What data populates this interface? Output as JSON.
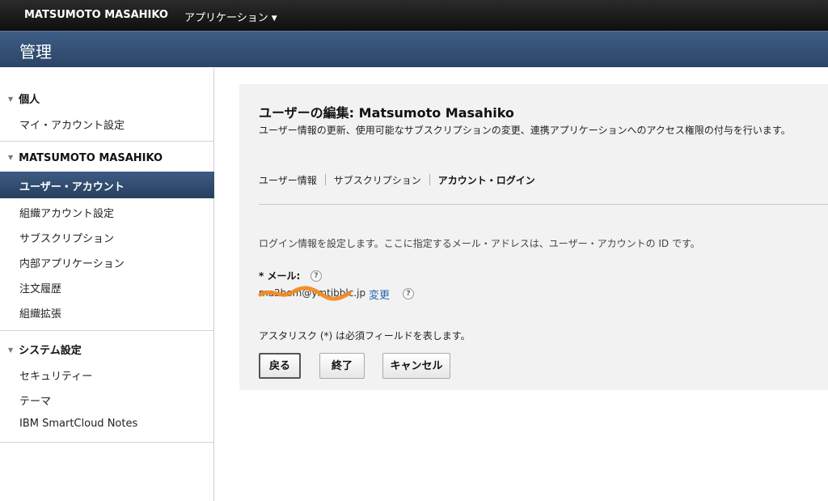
{
  "topbar": {
    "user_name": "MATSUMOTO MASAHIKO",
    "apps_label": "アプリケーション"
  },
  "header": {
    "title": "管理"
  },
  "sidebar": {
    "personal": {
      "heading": "個人",
      "items": [
        "マイ・アカウント設定"
      ]
    },
    "org": {
      "heading": "MATSUMOTO MASAHIKO",
      "items": [
        "ユーザー・アカウント",
        "組織アカウント設定",
        "サブスクリプション",
        "内部アプリケーション",
        "注文履歴",
        "組織拡張"
      ]
    },
    "system": {
      "heading": "システム設定",
      "items": [
        "セキュリティー",
        "テーマ",
        "IBM SmartCloud Notes"
      ]
    }
  },
  "main": {
    "title": "ユーザーの編集: Matsumoto Masahiko",
    "subtitle": "ユーザー情報の更新、使用可能なサブスクリプションの変更、連携アプリケーションへのアクセス権限の付与を行います。",
    "tabs": [
      "ユーザー情報",
      "サブスクリプション",
      "アカウント・ログイン"
    ],
    "active_tab": "アカウント・ログイン",
    "info_text": "ログイン情報を設定します。ここに指定するメール・アドレスは、ユーザー・アカウントの ID です。",
    "email_label": "* メール:",
    "email_value": "ma2bom@ymtibblc.jp",
    "change_link": "変更",
    "help_glyph": "?",
    "required_note": "アスタリスク (*) は必須フィールドを表します。",
    "buttons": {
      "back": "戻る",
      "finish": "終了",
      "cancel": "キャンセル"
    }
  },
  "colors": {
    "accent": "#2c4668",
    "link": "#2a66b0",
    "scribble": "#f28a1e"
  }
}
